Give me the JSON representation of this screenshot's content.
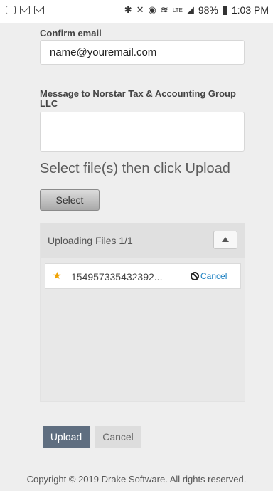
{
  "status_bar": {
    "battery": "98%",
    "time": "1:03 PM",
    "network": "LTE",
    "icons": [
      "chat-icon",
      "mail-icon",
      "mail-icon",
      "bluetooth-icon",
      "mute-icon",
      "alarm-icon",
      "wifi-icon",
      "signal-icon",
      "battery-icon"
    ]
  },
  "form": {
    "confirm_email_label": "Confirm email",
    "confirm_email_value": "name@youremail.com",
    "message_label": "Message to Norstar Tax & Accounting Group LLC",
    "message_value": ""
  },
  "upload": {
    "section_title": "Select file(s) then click Upload",
    "select_label": "Select",
    "panel_title": "Uploading Files 1/1",
    "files": [
      {
        "name": "154957335432392...",
        "cancel_label": "Cancel"
      }
    ],
    "upload_label": "Upload",
    "cancel_label": "Cancel"
  },
  "footer": {
    "copyright": "Copyright © 2019 Drake Software. All rights reserved."
  },
  "colors": {
    "upload_button": "#5f6e80",
    "cancel_link": "#1a7fc1",
    "star": "#f0a202"
  }
}
